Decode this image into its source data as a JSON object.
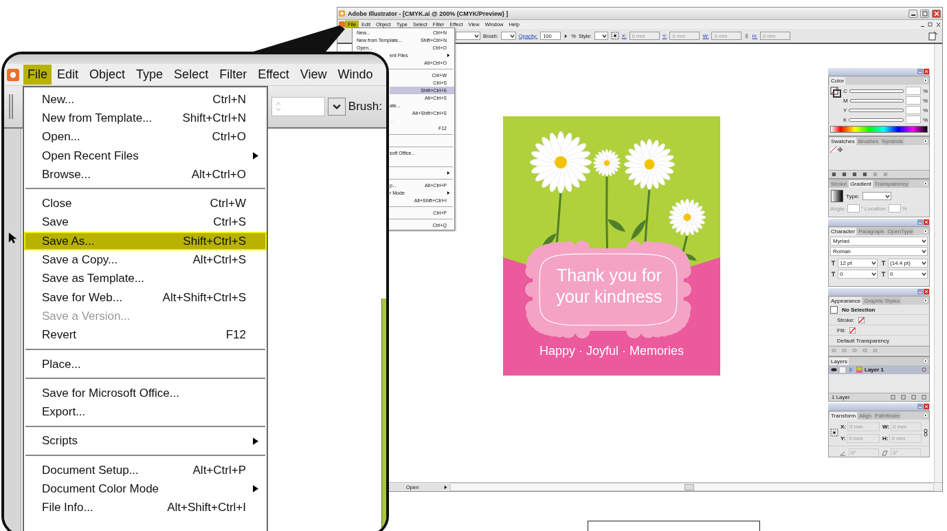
{
  "window": {
    "title": "Adobe Illustrator - [CMYK.ai @ 200% (CMYK/Preview) ]"
  },
  "menu_bar": [
    {
      "label": "File",
      "selected": true
    },
    {
      "label": "Edit",
      "selected": false
    },
    {
      "label": "Object",
      "selected": false
    },
    {
      "label": "Type",
      "selected": false
    },
    {
      "label": "Select",
      "selected": false
    },
    {
      "label": "Filter",
      "selected": false
    },
    {
      "label": "Effect",
      "selected": false
    },
    {
      "label": "View",
      "selected": false
    },
    {
      "label": "Window",
      "selected": false
    },
    {
      "label": "Help",
      "selected": false
    }
  ],
  "file_menu": {
    "groups": [
      [
        {
          "label": "New...",
          "shortcut": "Ctrl+N",
          "selected": false
        },
        {
          "label": "New from Template...",
          "shortcut": "Shift+Ctrl+N",
          "selected": false
        },
        {
          "label": "Open...",
          "shortcut": "Ctrl+O",
          "selected": false
        },
        {
          "label": "ent Files",
          "submenu": true,
          "selected": false
        },
        {
          "shortcut": "Alt+Ctrl+O",
          "selected": false
        }
      ],
      [
        {
          "shortcut": "Ctrl+W",
          "selected": false
        },
        {
          "shortcut": "Ctrl+S",
          "selected": false
        },
        {
          "shortcut": "Shift+Ctrl+S",
          "selected": true
        },
        {
          "shortcut": "Alt+Ctrl+S",
          "selected": false
        },
        {
          "label": "ate...",
          "selected": false
        },
        {
          "shortcut": "Alt+Shift+Ctrl+S",
          "selected": false
        },
        {
          "label": "...",
          "disabled": true,
          "selected": false
        },
        {
          "shortcut": "F12",
          "selected": false
        }
      ],
      [
        {
          "label": "soft Office...",
          "selected": false
        }
      ],
      [
        {
          "submenu": true,
          "selected": false
        }
      ],
      [
        {
          "label": "p...",
          "shortcut": "Alt+Ctrl+P",
          "selected": false
        },
        {
          "label": "r Mode",
          "submenu": true,
          "selected": false
        },
        {
          "shortcut": "Alt+Shift+Ctrl+I",
          "selected": false
        }
      ],
      [
        {
          "shortcut": "Ctrl+P",
          "selected": false
        }
      ],
      [
        {
          "shortcut": "Ctrl+Q",
          "selected": false
        }
      ]
    ]
  },
  "control_bar": {
    "brush_label": "Brush:",
    "opacity_label": "Opacity:",
    "opacity_value": "100",
    "percent_sign": "%",
    "style_label": "Style:",
    "fields": [
      {
        "label": "X:",
        "value": "0 mm"
      },
      {
        "label": "Y:",
        "value": "0 mm"
      },
      {
        "label": "W:",
        "value": "0 mm"
      },
      {
        "label": "H:",
        "value": "0 mm"
      }
    ]
  },
  "artboard": {
    "heading": "Thank you for your kindness",
    "tagline": "Happy · Joyful · Memories"
  },
  "panels": [
    {
      "kind": "color",
      "titlebar": true,
      "tabs": [
        {
          "label": "Color",
          "selected": true
        }
      ],
      "channels": [
        {
          "label": "C",
          "unit": "%"
        },
        {
          "label": "M",
          "unit": "%"
        },
        {
          "label": "Y",
          "unit": "%"
        },
        {
          "label": "K",
          "unit": "%"
        }
      ]
    },
    {
      "kind": "swatches",
      "titlebar": false,
      "tabs": [
        {
          "label": "Swatches",
          "selected": true
        },
        {
          "label": "Brushes",
          "selected": false
        },
        {
          "label": "Symbols",
          "selected": false
        }
      ]
    },
    {
      "kind": "gradient",
      "titlebar": false,
      "tabs": [
        {
          "label": "Stroke",
          "selected": false
        },
        {
          "label": "Gradient",
          "selected": true
        },
        {
          "label": "Transparency",
          "selected": false
        }
      ],
      "type_label": "Type:",
      "angle_label": "Angle:",
      "location_label": "° Location:",
      "percent_sign": "%"
    },
    {
      "kind": "character",
      "titlebar": true,
      "tabs": [
        {
          "label": "Character",
          "selected": true
        },
        {
          "label": "Paragraph",
          "selected": false
        },
        {
          "label": "OpenType",
          "selected": false
        }
      ],
      "font": "Myriad",
      "style": "Roman",
      "size": "12 pt",
      "leading": "(14.4 pt)",
      "kerning": "0",
      "tracking": "0"
    },
    {
      "kind": "appearance",
      "titlebar": true,
      "tabs": [
        {
          "label": "Appearance",
          "selected": true
        },
        {
          "label": "Graphic Styles",
          "selected": false
        }
      ],
      "rows": [
        {
          "label": "No Selection",
          "kind": "header"
        },
        {
          "label": "Stroke:",
          "kind": "swatch"
        },
        {
          "label": "Fill:",
          "kind": "swatch"
        },
        {
          "label": "Default Transparency",
          "kind": "plain"
        }
      ]
    },
    {
      "kind": "layers",
      "titlebar": false,
      "tabs": [
        {
          "label": "Layers",
          "selected": true
        }
      ],
      "layers": [
        {
          "name": "Layer 1",
          "selected": true
        }
      ],
      "footer": "1 Layer"
    },
    {
      "kind": "transform",
      "titlebar": true,
      "tabs": [
        {
          "label": "Transform",
          "selected": true
        },
        {
          "label": "Align",
          "selected": false
        },
        {
          "label": "Pathfinder",
          "selected": false
        }
      ],
      "fields": [
        {
          "label": "X:",
          "value": "0 mm"
        },
        {
          "label": "W:",
          "value": "0 mm"
        },
        {
          "label": "Y:",
          "value": "0 mm"
        },
        {
          "label": "H:",
          "value": "0 mm"
        }
      ],
      "angle": "0°",
      "shear": "0°"
    }
  ],
  "status_bar": {
    "label": "Open"
  },
  "callout": {
    "menu_bar": [
      {
        "label": "File",
        "selected": true
      },
      {
        "label": "Edit",
        "selected": false
      },
      {
        "label": "Object",
        "selected": false
      },
      {
        "label": "Type",
        "selected": false
      },
      {
        "label": "Select",
        "selected": false
      },
      {
        "label": "Filter",
        "selected": false
      },
      {
        "label": "Effect",
        "selected": false
      },
      {
        "label": "View",
        "selected": false
      },
      {
        "label": "Windo",
        "selected": false
      }
    ],
    "brush_label": "Brush:",
    "file_menu": {
      "groups": [
        [
          {
            "label": "New...",
            "shortcut": "Ctrl+N",
            "selected": false
          },
          {
            "label": "New from Template...",
            "shortcut": "Shift+Ctrl+N",
            "selected": false
          },
          {
            "label": "Open...",
            "shortcut": "Ctrl+O",
            "selected": false
          },
          {
            "label": "Open Recent Files",
            "submenu": true,
            "selected": false
          },
          {
            "label": "Browse...",
            "shortcut": "Alt+Ctrl+O",
            "selected": false
          }
        ],
        [
          {
            "label": "Close",
            "shortcut": "Ctrl+W",
            "selected": false
          },
          {
            "label": "Save",
            "shortcut": "Ctrl+S",
            "selected": false
          },
          {
            "label": "Save As...",
            "shortcut": "Shift+Ctrl+S",
            "selected": true
          },
          {
            "label": "Save a Copy...",
            "shortcut": "Alt+Ctrl+S",
            "selected": false
          },
          {
            "label": "Save as Template...",
            "selected": false
          },
          {
            "label": "Save for Web...",
            "shortcut": "Alt+Shift+Ctrl+S",
            "selected": false
          },
          {
            "label": "Save a Version...",
            "disabled": true,
            "selected": false
          },
          {
            "label": "Revert",
            "shortcut": "F12",
            "selected": false
          }
        ],
        [
          {
            "label": "Place...",
            "selected": false
          }
        ],
        [
          {
            "label": "Save for Microsoft Office...",
            "selected": false
          },
          {
            "label": "Export...",
            "selected": false
          }
        ],
        [
          {
            "label": "Scripts",
            "submenu": true,
            "selected": false
          }
        ],
        [
          {
            "label": "Document Setup...",
            "shortcut": "Alt+Ctrl+P",
            "selected": false
          },
          {
            "label": "Document Color Mode",
            "submenu": true,
            "selected": false
          },
          {
            "label": "File Info...",
            "shortcut": "Alt+Shift+Ctrl+I",
            "selected": false
          }
        ]
      ]
    }
  }
}
